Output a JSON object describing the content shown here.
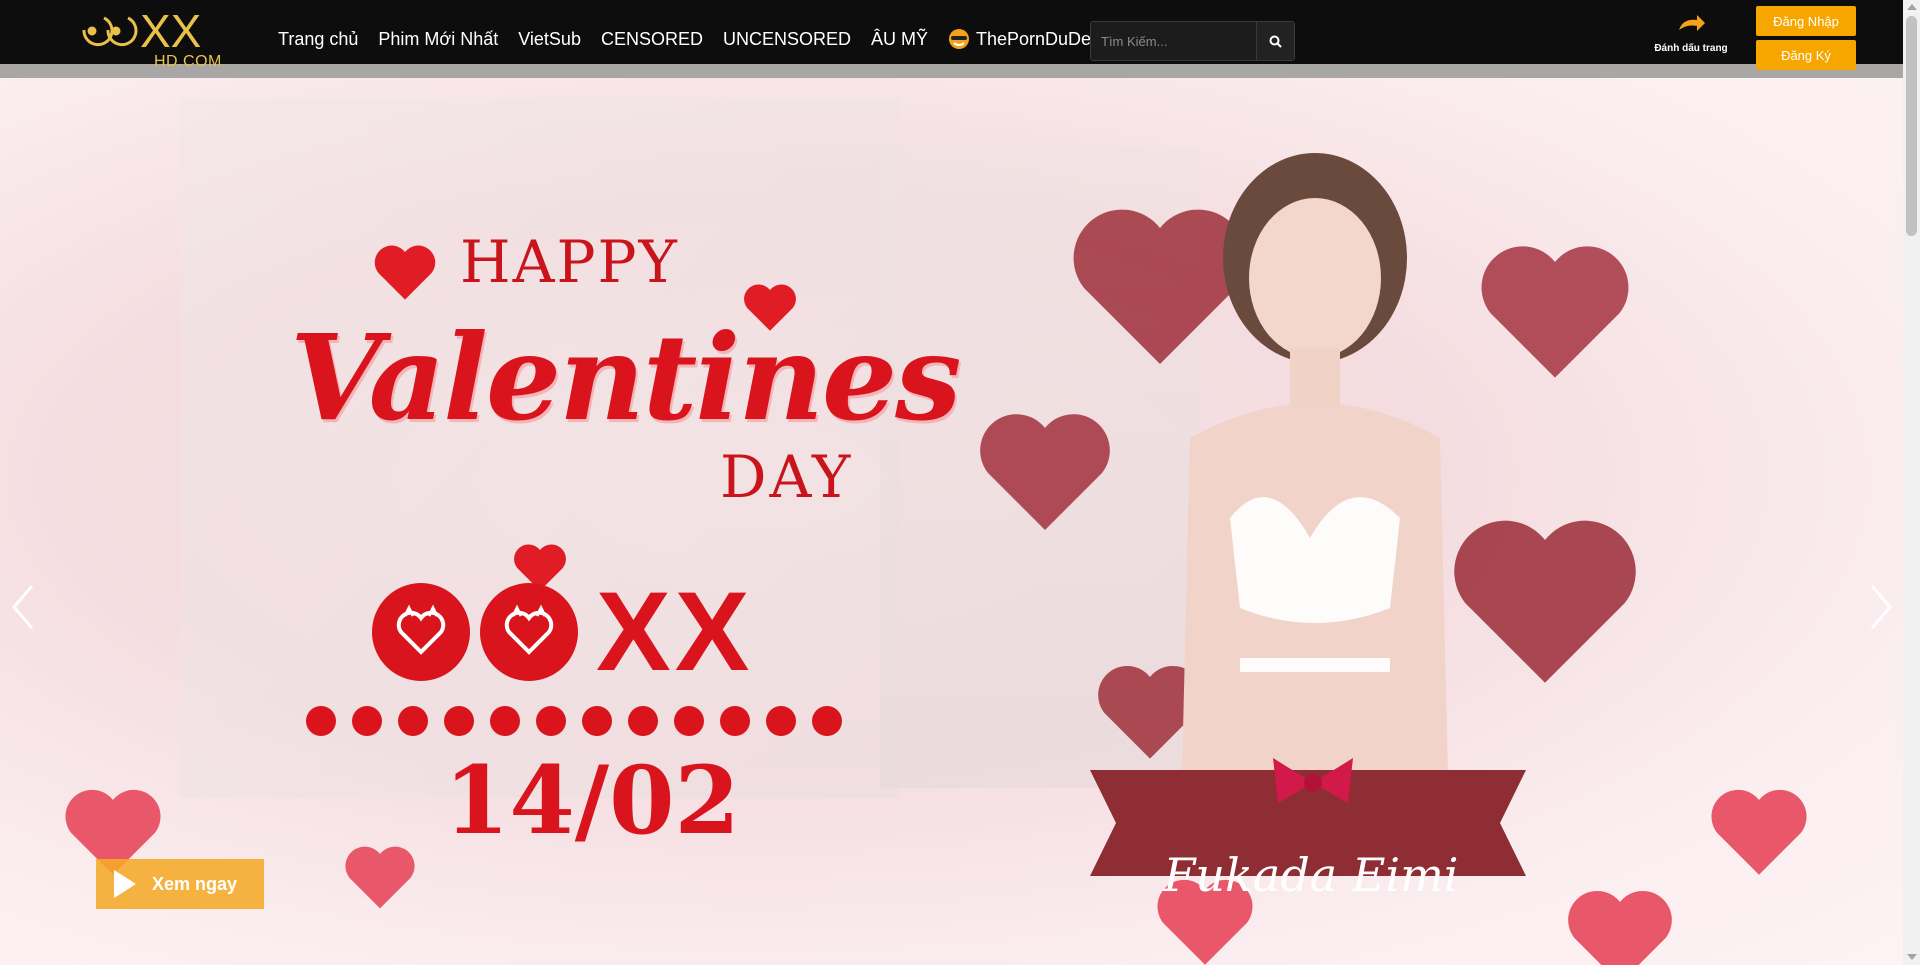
{
  "header": {
    "logo_sub": "HD.COM",
    "nav": [
      {
        "label": "Trang chủ"
      },
      {
        "label": "Phim Mới Nhất"
      },
      {
        "label": "VietSub"
      },
      {
        "label": "CENSORED"
      },
      {
        "label": "UNCENSORED"
      },
      {
        "label": "ÂU MỸ"
      },
      {
        "label": "ThePornDuDe",
        "icon": "porndude-icon"
      }
    ],
    "search": {
      "placeholder": "Tìm Kiếm...",
      "icon": "search-icon"
    },
    "bookmark": {
      "label": "Đánh dấu trang",
      "icon": "bookmark-arrow-icon"
    },
    "login_label": "Đăng Nhập",
    "register_label": "Đăng Ký"
  },
  "hero": {
    "happy": "HAPPY",
    "valentines": "Valentines",
    "day": "DAY",
    "brand_xx": "XX",
    "date": "14/02",
    "name": "Fukada Eimi",
    "watch_label": "Xem ngay",
    "dot_count": 12
  },
  "colors": {
    "header_bg": "#0d0d0d",
    "accent_yellow": "#f7a600",
    "valentine_red": "#d9141c",
    "banner_maroon": "#8e2d33"
  }
}
